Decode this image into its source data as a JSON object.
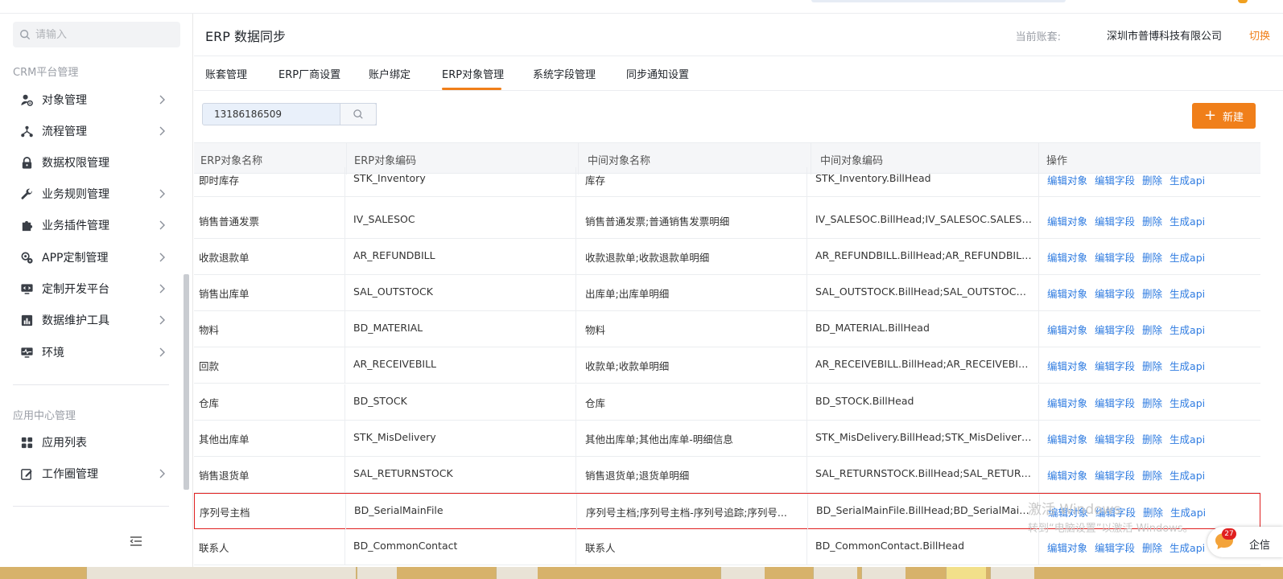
{
  "sidebar": {
    "search_placeholder": "请输入",
    "group1_title": "CRM平台管理",
    "group1_items": [
      {
        "label": "对象管理",
        "icon": "user-gear-icon",
        "has_children": true
      },
      {
        "label": "流程管理",
        "icon": "flow-icon",
        "has_children": true
      },
      {
        "label": "数据权限管理",
        "icon": "lock-icon",
        "has_children": false
      },
      {
        "label": "业务规则管理",
        "icon": "wrench-icon",
        "has_children": true
      },
      {
        "label": "业务插件管理",
        "icon": "puzzle-icon",
        "has_children": true
      },
      {
        "label": "APP定制管理",
        "icon": "app-gear-icon",
        "has_children": true
      },
      {
        "label": "定制开发平台",
        "icon": "code-monitor-icon",
        "has_children": true
      },
      {
        "label": "数据维护工具",
        "icon": "bar-chart-icon",
        "has_children": true
      },
      {
        "label": "环境",
        "icon": "pulse-monitor-icon",
        "has_children": true
      }
    ],
    "group2_title": "应用中心管理",
    "group2_items": [
      {
        "label": "应用列表",
        "icon": "grid-icon",
        "has_children": false
      },
      {
        "label": "工作圈管理",
        "icon": "edit-icon",
        "has_children": true
      }
    ]
  },
  "header": {
    "title": "ERP 数据同步",
    "account_label": "当前账套:",
    "account_name": "深圳市普博科技有限公司",
    "switch_label": "切换"
  },
  "tabs": [
    "账套管理",
    "ERP厂商设置",
    "账户绑定",
    "ERP对象管理",
    "系统字段管理",
    "同步通知设置"
  ],
  "active_tab": "ERP对象管理",
  "filter": {
    "value": "13186186509"
  },
  "new_button": {
    "label": "新建"
  },
  "table": {
    "columns": [
      "ERP对象名称",
      "ERP对象编码",
      "中间对象名称",
      "中间对象编码",
      "操作"
    ],
    "row_actions": [
      "编辑对象",
      "编辑字段",
      "删除",
      "生成api"
    ],
    "rows": [
      [
        "即时库存",
        "STK_Inventory",
        "库存",
        "STK_Inventory.BillHead"
      ],
      [
        "销售普通发票",
        "IV_SALESOC",
        "销售普通发票;普通销售发票明细",
        "IV_SALESOC.BillHead;IV_SALESOC.SALESIC..."
      ],
      [
        "收款退款单",
        "AR_REFUNDBILL",
        "收款退款单;收款退款单明细",
        "AR_REFUNDBILL.BillHead;AR_REFUNDBILL...."
      ],
      [
        "销售出库单",
        "SAL_OUTSTOCK",
        "出库单;出库单明细",
        "SAL_OUTSTOCK.BillHead;SAL_OUTSTOCK.E..."
      ],
      [
        "物料",
        "BD_MATERIAL",
        "物料",
        "BD_MATERIAL.BillHead"
      ],
      [
        "回款",
        "AR_RECEIVEBILL",
        "收款单;收款单明细",
        "AR_RECEIVEBILL.BillHead;AR_RECEIVEBILL...."
      ],
      [
        "仓库",
        "BD_STOCK",
        "仓库",
        "BD_STOCK.BillHead"
      ],
      [
        "其他出库单",
        "STK_MisDelivery",
        "其他出库单;其他出库单-明细信息",
        "STK_MisDelivery.BillHead;STK_MisDelivery.Bi..."
      ],
      [
        "销售退货单",
        "SAL_RETURNSTOCK",
        "销售退货单;退货单明细",
        "SAL_RETURNSTOCK.BillHead;SAL_RETURNS..."
      ],
      [
        "序列号主档",
        "BD_SerialMainFile",
        "序列号主档;序列号主档-序列号追踪;序列号...",
        "BD_SerialMainFile.BillHead;BD_SerialMainFile..."
      ],
      [
        "联系人",
        "BD_CommonContact",
        "联系人",
        "BD_CommonContact.BillHead"
      ]
    ],
    "highlighted_row": 9
  },
  "overlays": {
    "watermark_line1": "激活 Windows",
    "watermark_line2": "转到“电脑设置”以激活 Windows。",
    "chat_count": "27",
    "chat_label": "企信"
  },
  "colors": {
    "accent": "#f07f1a",
    "link": "#2e7be0",
    "highlight_border": "#e02020"
  }
}
